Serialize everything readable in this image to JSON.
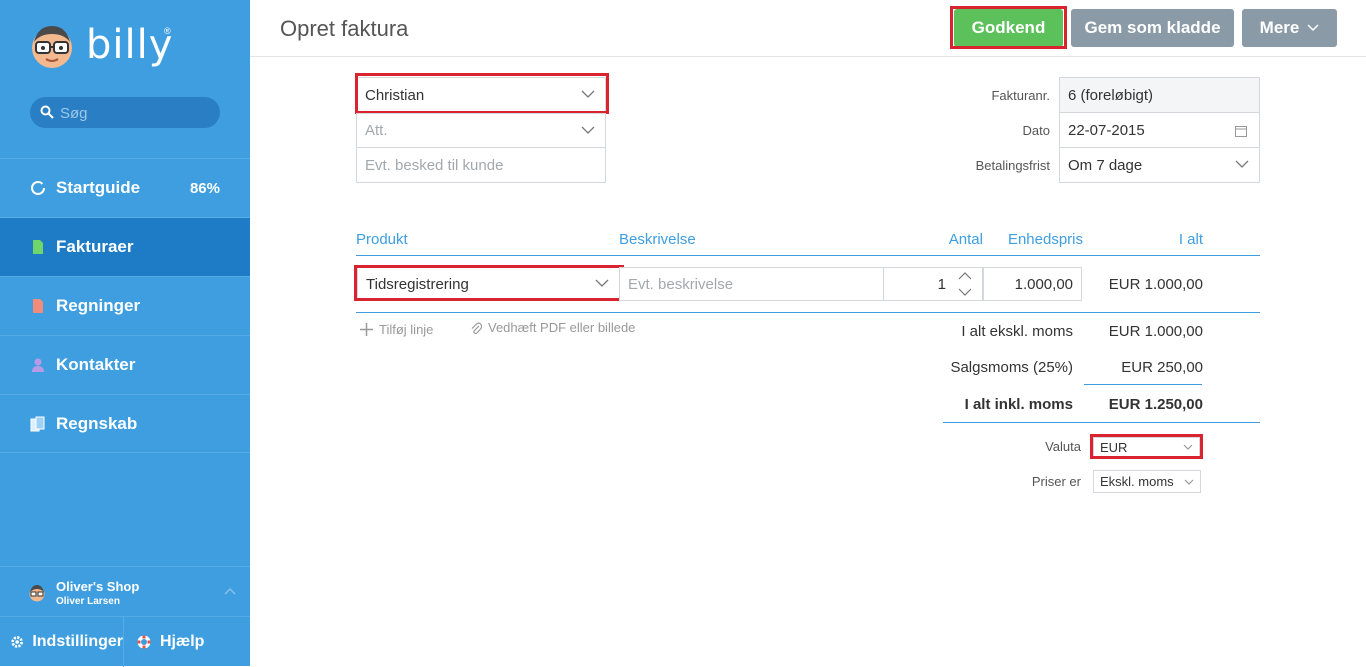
{
  "app": {
    "logo": "billy",
    "logo_mark": "®"
  },
  "search": {
    "placeholder": "Søg"
  },
  "sidebar": {
    "items": [
      {
        "label": "Startguide",
        "badge": "86%",
        "icon": "progress-ring-icon"
      },
      {
        "label": "Fakturaer",
        "icon": "invoice-icon",
        "active": true
      },
      {
        "label": "Regninger",
        "icon": "bill-icon"
      },
      {
        "label": "Kontakter",
        "icon": "person-icon"
      },
      {
        "label": "Regnskab",
        "icon": "ledger-icon"
      }
    ],
    "shop": {
      "name": "Oliver's Shop",
      "user": "Oliver Larsen"
    },
    "settings_label": "Indstillinger",
    "help_label": "Hjælp"
  },
  "header": {
    "title": "Opret faktura",
    "approve_label": "Godkend",
    "draft_label": "Gem som kladde",
    "more_label": "Mere"
  },
  "customer": {
    "value": "Christian",
    "att_placeholder": "Att.",
    "message_placeholder": "Evt. besked til kunde"
  },
  "meta": {
    "invoice_no_label": "Fakturanr.",
    "invoice_no_value": "6 (foreløbigt)",
    "date_label": "Dato",
    "date_value": "22-07-2015",
    "due_label": "Betalingsfrist",
    "due_value": "Om 7 dage"
  },
  "lines": {
    "headers": {
      "product": "Produkt",
      "description": "Beskrivelse",
      "qty": "Antal",
      "unit_price": "Enhedspris",
      "total": "I alt"
    },
    "rows": [
      {
        "product": "Tidsregistrering",
        "description_placeholder": "Evt. beskrivelse",
        "qty": "1",
        "unit_price": "1.000,00",
        "total": "EUR 1.000,00"
      }
    ],
    "add_line_label": "Tilføj linje",
    "attach_label": "Vedhæft PDF eller billede"
  },
  "totals": {
    "excl_label": "I alt ekskl. moms",
    "excl_value": "EUR 1.000,00",
    "vat_label": "Salgsmoms (25%)",
    "vat_value": "EUR 250,00",
    "incl_label": "I alt inkl. moms",
    "incl_value": "EUR 1.250,00"
  },
  "options": {
    "currency_label": "Valuta",
    "currency_value": "EUR",
    "prices_label": "Priser er",
    "prices_value": "Ekskl. moms"
  },
  "colors": {
    "sidebar": "#3e9ee0",
    "active": "#1e7bc5",
    "approve": "#5cc15b",
    "secondary": "#8a9aa6",
    "highlight": "#d9242f"
  }
}
